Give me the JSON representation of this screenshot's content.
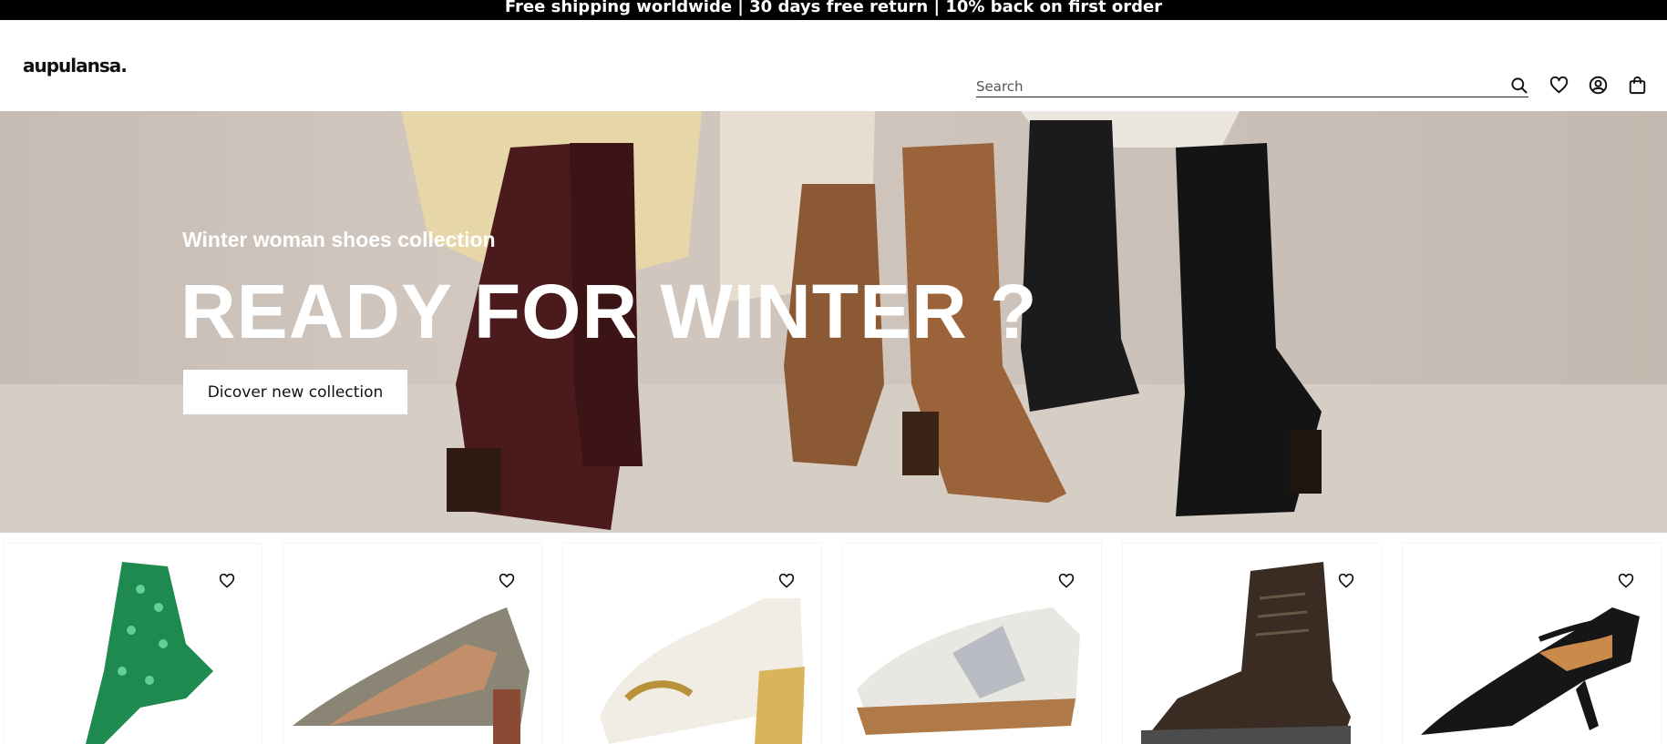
{
  "announcement": "Free shipping worldwide | 30 days free return | 10% back on first order",
  "header": {
    "logo": "aupulansa.",
    "search": {
      "placeholder": "Search",
      "value": ""
    },
    "icons": [
      "search-icon",
      "heart-icon",
      "account-icon",
      "bag-icon"
    ]
  },
  "hero": {
    "subtitle": "Winter woman shoes collection",
    "title": "READY FOR WINTER ?",
    "cta": "Dicover new collection"
  },
  "products": [
    {
      "name": "green-studded-boot",
      "colors": [
        "#1e8a4f"
      ]
    },
    {
      "name": "snakeskin-slingback",
      "colors": [
        "#8a8574"
      ]
    },
    {
      "name": "white-fur-loafer",
      "colors": [
        "#f1ede4"
      ]
    },
    {
      "name": "white-silver-sneaker",
      "colors": [
        "#e9e7e2"
      ]
    },
    {
      "name": "brown-lace-up-boot",
      "colors": [
        "#3a2c22"
      ]
    },
    {
      "name": "black-studded-maryjane",
      "colors": [
        "#161616"
      ]
    }
  ],
  "colors": {
    "announce_bg": "#000000",
    "accent": "#111111"
  }
}
